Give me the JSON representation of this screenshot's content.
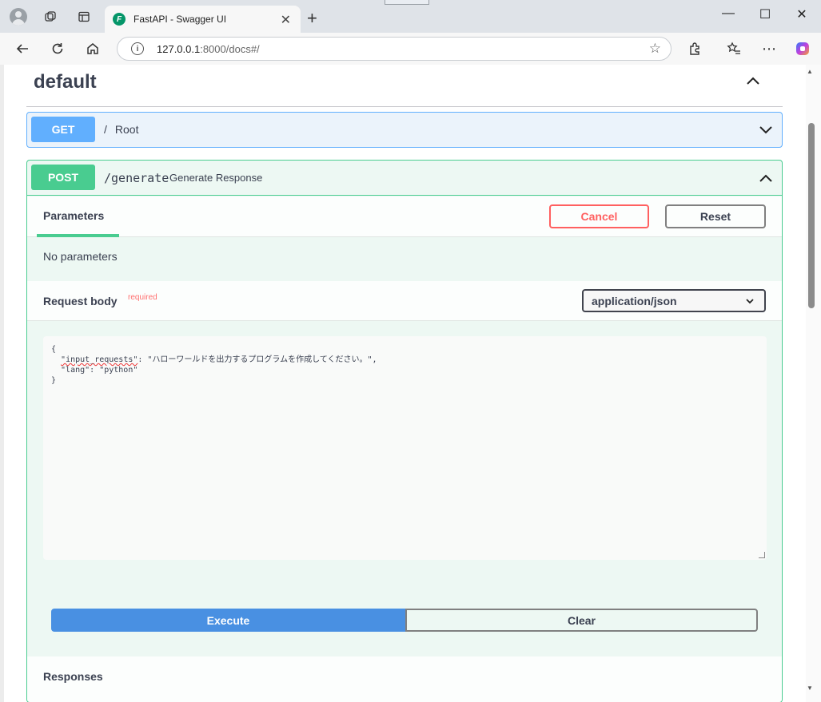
{
  "browser": {
    "tab_title": "FastAPI - Swagger UI",
    "favicon_letter": "F",
    "url_host": "127.0.0.1",
    "url_rest": ":8000/docs#/"
  },
  "swagger": {
    "tag": "default",
    "get_op": {
      "method": "GET",
      "path": "/",
      "summary": "Root"
    },
    "post_op": {
      "method": "POST",
      "path": "/generate",
      "summary": "Generate Response",
      "parameters_tab": "Parameters",
      "cancel_label": "Cancel",
      "reset_label": "Reset",
      "no_params": "No parameters",
      "request_body_label": "Request body",
      "required_label": "required",
      "content_type": "application/json",
      "body_line1": "{",
      "body_key1": "\"input_requests\"",
      "body_val1": ": \"ハローワールドを出力するプログラムを作成してください。\",",
      "body_line3": "  \"lang\": \"python\"",
      "body_line4": "}",
      "execute_label": "Execute",
      "clear_label": "Clear",
      "responses_label": "Responses"
    }
  },
  "colors": {
    "get": "#61affe",
    "post": "#49cc90",
    "execute": "#4990e2",
    "cancel": "#ff6060"
  }
}
